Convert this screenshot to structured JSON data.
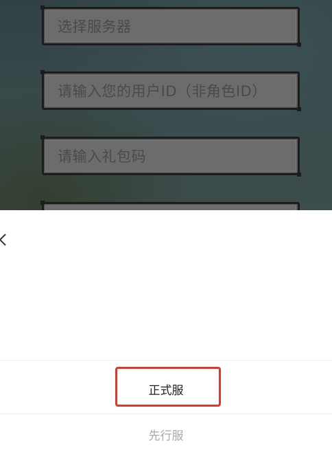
{
  "form": {
    "server_placeholder": "选择服务器",
    "user_id_placeholder": "请输入您的用户ID（非角色ID）",
    "gift_code_placeholder": "请输入礼包码"
  },
  "sheet": {
    "close_icon": "chevron-left-icon",
    "options": [
      {
        "label": "正式服"
      },
      {
        "label": "先行服"
      }
    ]
  },
  "colors": {
    "highlight": "#d83a2e",
    "field_bg": "#6c6c6c",
    "field_border": "#1c1c1c"
  }
}
